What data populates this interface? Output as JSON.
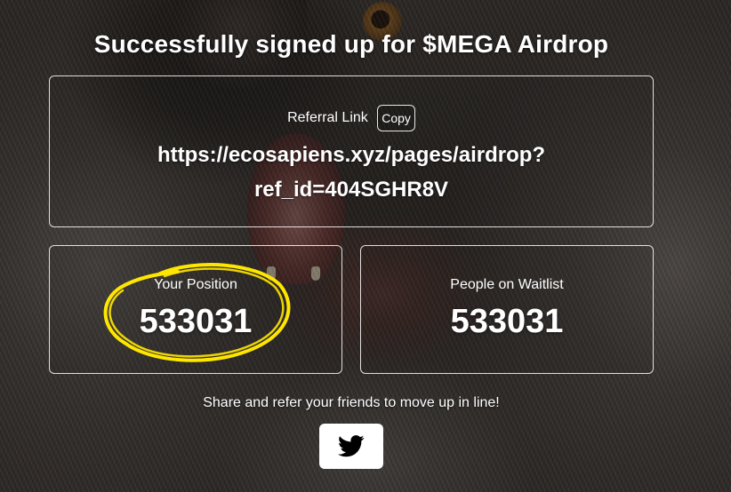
{
  "page": {
    "title": "Successfully signed up for $MEGA Airdrop"
  },
  "referral": {
    "label": "Referral Link",
    "copy_button": "Copy",
    "link_line1": "https://ecosapiens.xyz/pages/airdrop?",
    "link_line2": "ref_id=404SGHR8V"
  },
  "stats": {
    "position": {
      "label": "Your Position",
      "value": "533031"
    },
    "waitlist": {
      "label": "People on Waitlist",
      "value": "533031"
    }
  },
  "share": {
    "text": "Share and refer your friends to move up in line!",
    "twitter_icon": "twitter-bird-icon"
  },
  "colors": {
    "highlight_scribble": "#ffe600",
    "button_bg": "#ffffff",
    "icon": "#000000",
    "text": "#ffffff"
  }
}
